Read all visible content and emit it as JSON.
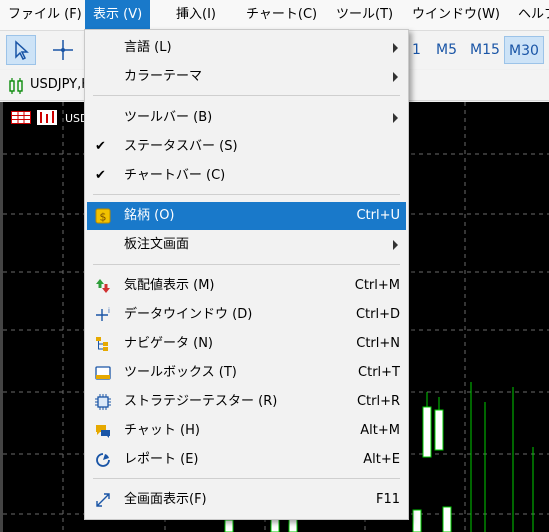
{
  "menubar": {
    "items": [
      "ファイル (F)",
      "表示 (V)",
      "挿入(I)",
      "チャート(C)",
      "ツール(T)",
      "ウインドウ(W)",
      "ヘルプ"
    ]
  },
  "toolbar": {
    "timeframes": [
      "1",
      "M5",
      "M15",
      "M30"
    ]
  },
  "chart_tab": {
    "label": "USDJPY,H"
  },
  "chart": {
    "symbol": "USD"
  },
  "view_menu": {
    "items": [
      {
        "label": "言語 (L)",
        "submenu": true
      },
      {
        "label": "カラーテーマ",
        "submenu": true
      },
      {
        "label": "ツールバー (B)",
        "submenu": true
      },
      {
        "label": "ステータスバー (S)",
        "checked": true
      },
      {
        "label": "チャートバー (C)",
        "checked": true
      },
      {
        "label": "銘柄 (O)",
        "shortcut": "Ctrl+U",
        "icon": "dollar-coin-icon",
        "highlighted": true
      },
      {
        "label": "板注文画面",
        "submenu": true
      },
      {
        "label": "気配値表示 (M)",
        "shortcut": "Ctrl+M",
        "icon": "market-watch-icon"
      },
      {
        "label": "データウインドウ (D)",
        "shortcut": "Ctrl+D",
        "icon": "data-window-icon"
      },
      {
        "label": "ナビゲータ (N)",
        "shortcut": "Ctrl+N",
        "icon": "navigator-icon"
      },
      {
        "label": "ツールボックス (T)",
        "shortcut": "Ctrl+T",
        "icon": "toolbox-icon"
      },
      {
        "label": "ストラテジーテスター (R)",
        "shortcut": "Ctrl+R",
        "icon": "strategy-tester-icon"
      },
      {
        "label": "チャット (H)",
        "shortcut": "Alt+M",
        "icon": "chat-icon"
      },
      {
        "label": "レポート (E)",
        "shortcut": "Alt+E",
        "icon": "report-icon"
      },
      {
        "label": "全画面表示(F)",
        "shortcut": "F11",
        "icon": "fullscreen-icon"
      }
    ]
  },
  "colors": {
    "accent": "#1979ca",
    "chart_bg": "#000000",
    "candle_up": "#00cc00"
  }
}
